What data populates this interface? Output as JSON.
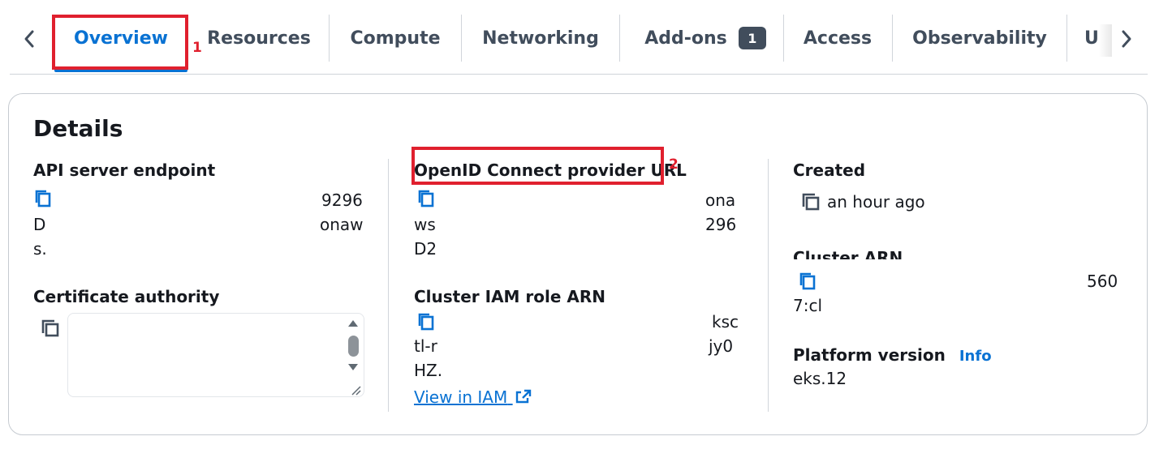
{
  "tabs": {
    "items": [
      {
        "label": "Overview",
        "active": true
      },
      {
        "label": "Resources"
      },
      {
        "label": "Compute"
      },
      {
        "label": "Networking"
      },
      {
        "label": "Add-ons",
        "badge": "1"
      },
      {
        "label": "Access"
      },
      {
        "label": "Observability"
      },
      {
        "label": "U"
      }
    ]
  },
  "annotations": {
    "one": "1",
    "two": "2"
  },
  "details": {
    "title": "Details",
    "api_endpoint": {
      "label": "API server endpoint",
      "line1": "9296",
      "line2a": "D",
      "line2b": "onaw",
      "line3": "s."
    },
    "cert_authority": {
      "label": "Certificate authority"
    },
    "oidc": {
      "label": "OpenID Connect provider URL",
      "line1": "ona",
      "line2a": "ws",
      "line2b": "296",
      "line3": "D2"
    },
    "iam_role": {
      "label": "Cluster IAM role ARN",
      "line1": "ksc",
      "line2a": "tl-r",
      "line2b": "jy0",
      "line3": "HZ.",
      "link": "View in IAM"
    },
    "created": {
      "label": "Created",
      "value": "an hour ago"
    },
    "cluster_arn": {
      "label": "Cluster ARN",
      "line1": "560",
      "line2": "7:cl"
    },
    "platform": {
      "label": "Platform version",
      "info": "Info",
      "value": "eks.12"
    }
  },
  "colors": {
    "accent": "#0972d3",
    "annotation": "#e0202e",
    "badge": "#414d5c"
  }
}
